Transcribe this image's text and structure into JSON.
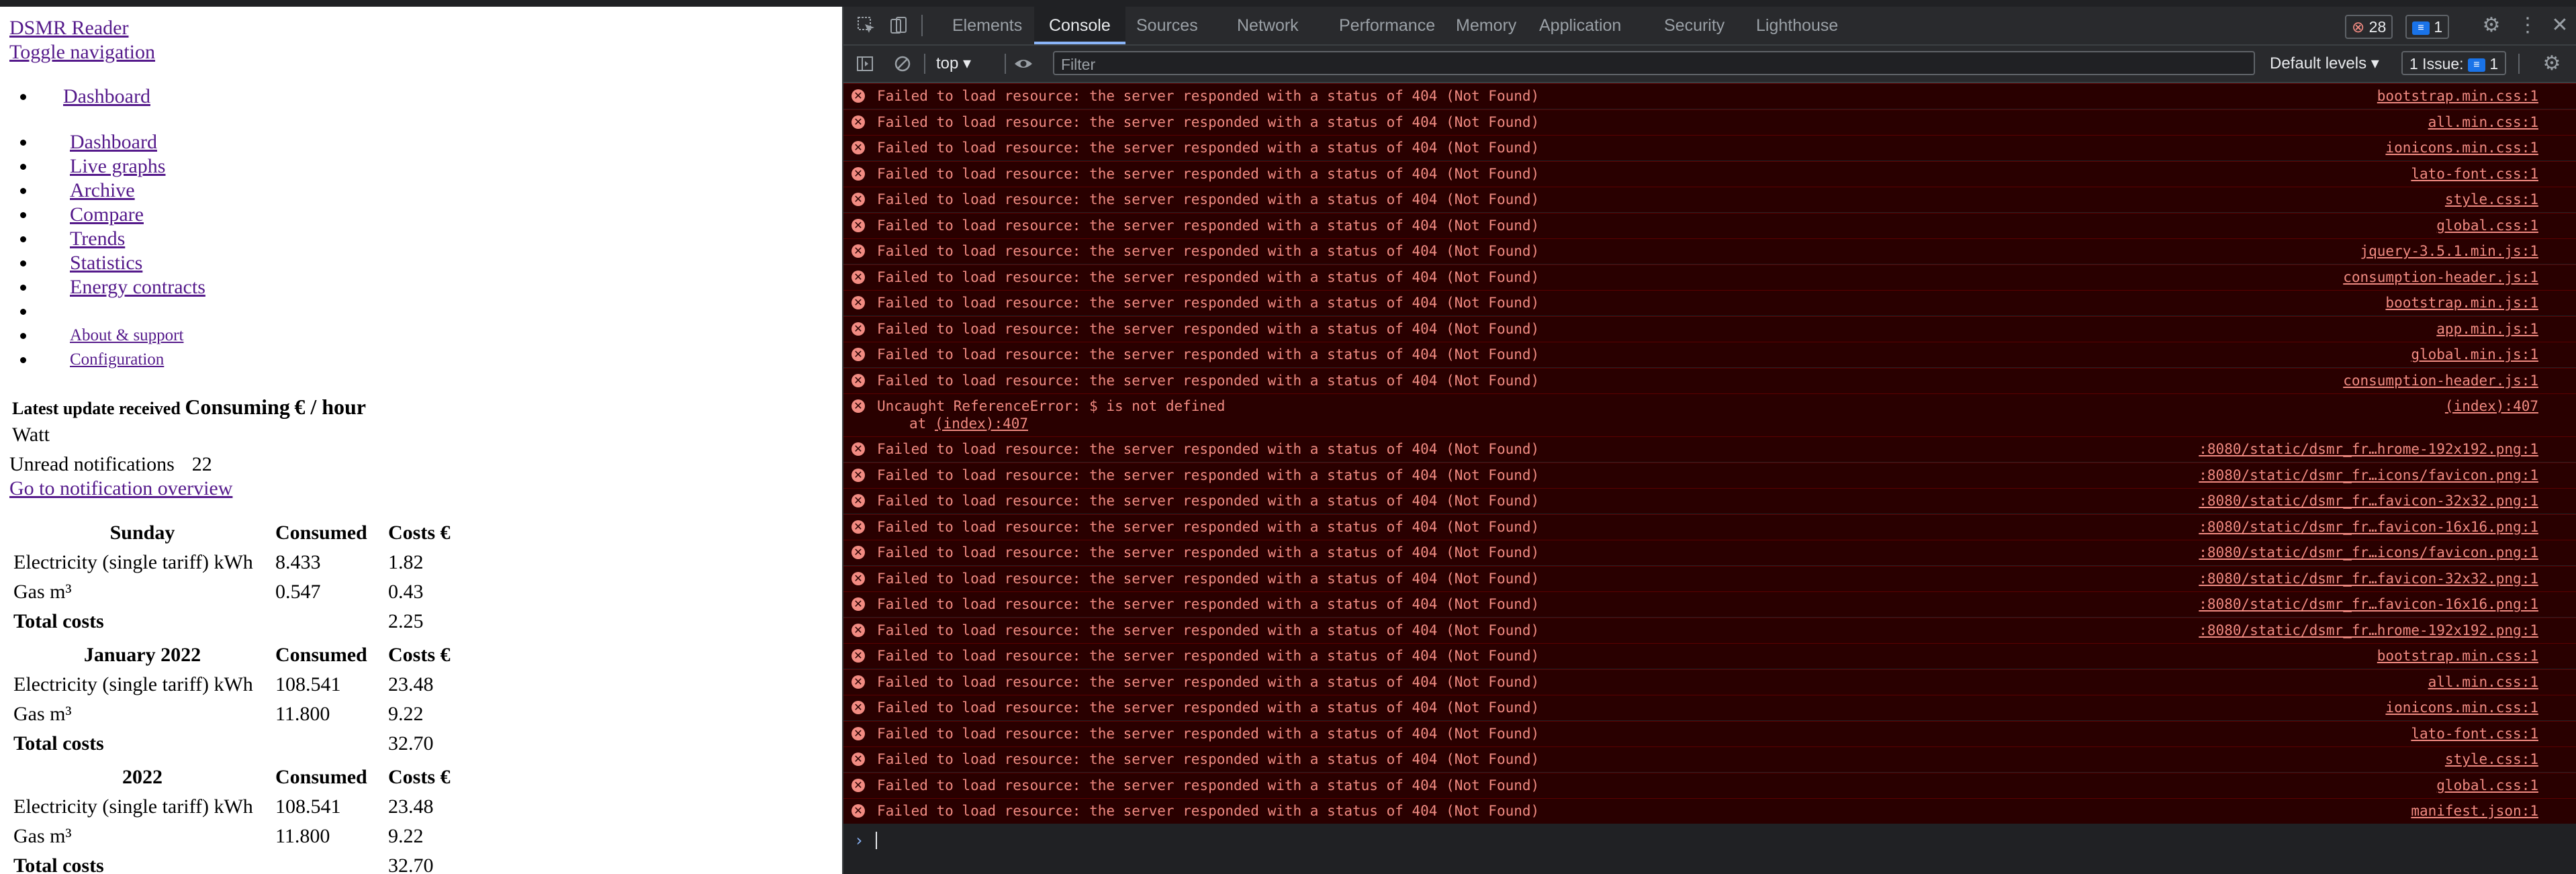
{
  "page": {
    "brand": "DSMR Reader",
    "toggle": "Toggle navigation",
    "nav_dashboard": "Dashboard",
    "menu": [
      {
        "label": "Dashboard",
        "small": false
      },
      {
        "label": "Live graphs",
        "small": false
      },
      {
        "label": "Archive",
        "small": false
      },
      {
        "label": "Compare",
        "small": false
      },
      {
        "label": "Trends",
        "small": false
      },
      {
        "label": "Statistics",
        "small": false
      },
      {
        "label": "Energy contracts",
        "small": false
      },
      {
        "label": "",
        "small": false
      },
      {
        "label": "About & support",
        "small": true
      },
      {
        "label": "Configuration",
        "small": true
      }
    ],
    "latest_update": "Latest update received",
    "consuming": "Consuming",
    "per_hour": "€ / hour",
    "watt": "Watt",
    "unread_label": "Unread notifications",
    "unread_count": "22",
    "notif_link": "Go to notification overview",
    "tables": [
      {
        "heading": "Sunday",
        "consumed": "Consumed",
        "costs": "Costs €",
        "rows": [
          {
            "label": "Electricity (single tariff) kWh",
            "consumed": "8.433",
            "costs": "1.82"
          },
          {
            "label": "Gas m³",
            "consumed": "0.547",
            "costs": "0.43"
          }
        ],
        "total_label": "Total costs",
        "total": "2.25"
      },
      {
        "heading": "January 2022",
        "consumed": "Consumed",
        "costs": "Costs €",
        "rows": [
          {
            "label": "Electricity (single tariff) kWh",
            "consumed": "108.541",
            "costs": "23.48"
          },
          {
            "label": "Gas m³",
            "consumed": "11.800",
            "costs": "9.22"
          }
        ],
        "total_label": "Total costs",
        "total": "32.70"
      },
      {
        "heading": "2022",
        "consumed": "Consumed",
        "costs": "Costs €",
        "rows": [
          {
            "label": "Electricity (single tariff) kWh",
            "consumed": "108.541",
            "costs": "23.48"
          },
          {
            "label": "Gas m³",
            "consumed": "11.800",
            "costs": "9.22"
          }
        ],
        "total_label": "Total costs",
        "total": "32.70"
      }
    ]
  },
  "devtools": {
    "tabs": [
      "Elements",
      "Console",
      "Sources",
      "Network",
      "Performance",
      "Memory",
      "Application",
      "Security",
      "Lighthouse"
    ],
    "active_tab": "Console",
    "error_count": "28",
    "message_count": "1",
    "context": "top",
    "filter_placeholder": "Filter",
    "levels": "Default levels",
    "issues_label": "1 Issue:",
    "issues_count": "1",
    "messages": [
      {
        "text": "Failed to load resource: the server responded with a status of 404 (Not Found)",
        "source": "bootstrap.min.css:1"
      },
      {
        "text": "Failed to load resource: the server responded with a status of 404 (Not Found)",
        "source": "all.min.css:1"
      },
      {
        "text": "Failed to load resource: the server responded with a status of 404 (Not Found)",
        "source": "ionicons.min.css:1"
      },
      {
        "text": "Failed to load resource: the server responded with a status of 404 (Not Found)",
        "source": "lato-font.css:1"
      },
      {
        "text": "Failed to load resource: the server responded with a status of 404 (Not Found)",
        "source": "style.css:1"
      },
      {
        "text": "Failed to load resource: the server responded with a status of 404 (Not Found)",
        "source": "global.css:1"
      },
      {
        "text": "Failed to load resource: the server responded with a status of 404 (Not Found)",
        "source": "jquery-3.5.1.min.js:1"
      },
      {
        "text": "Failed to load resource: the server responded with a status of 404 (Not Found)",
        "source": "consumption-header.js:1"
      },
      {
        "text": "Failed to load resource: the server responded with a status of 404 (Not Found)",
        "source": "bootstrap.min.js:1"
      },
      {
        "text": "Failed to load resource: the server responded with a status of 404 (Not Found)",
        "source": "app.min.js:1"
      },
      {
        "text": "Failed to load resource: the server responded with a status of 404 (Not Found)",
        "source": "global.min.js:1"
      },
      {
        "text": "Failed to load resource: the server responded with a status of 404 (Not Found)",
        "source": "consumption-header.js:1"
      },
      {
        "text": "Uncaught ReferenceError: $ is not defined",
        "source": "(index):407",
        "at_prefix": "at",
        "at_link": "(index):407"
      },
      {
        "text": "Failed to load resource: the server responded with a status of 404 (Not Found)",
        "source": ":8080/static/dsmr_fr…hrome-192x192.png:1"
      },
      {
        "text": "Failed to load resource: the server responded with a status of 404 (Not Found)",
        "source": ":8080/static/dsmr_fr…icons/favicon.png:1"
      },
      {
        "text": "Failed to load resource: the server responded with a status of 404 (Not Found)",
        "source": ":8080/static/dsmr_fr…favicon-32x32.png:1"
      },
      {
        "text": "Failed to load resource: the server responded with a status of 404 (Not Found)",
        "source": ":8080/static/dsmr_fr…favicon-16x16.png:1"
      },
      {
        "text": "Failed to load resource: the server responded with a status of 404 (Not Found)",
        "source": ":8080/static/dsmr_fr…icons/favicon.png:1"
      },
      {
        "text": "Failed to load resource: the server responded with a status of 404 (Not Found)",
        "source": ":8080/static/dsmr_fr…favicon-32x32.png:1"
      },
      {
        "text": "Failed to load resource: the server responded with a status of 404 (Not Found)",
        "source": ":8080/static/dsmr_fr…favicon-16x16.png:1"
      },
      {
        "text": "Failed to load resource: the server responded with a status of 404 (Not Found)",
        "source": ":8080/static/dsmr_fr…hrome-192x192.png:1"
      },
      {
        "text": "Failed to load resource: the server responded with a status of 404 (Not Found)",
        "source": "bootstrap.min.css:1"
      },
      {
        "text": "Failed to load resource: the server responded with a status of 404 (Not Found)",
        "source": "all.min.css:1"
      },
      {
        "text": "Failed to load resource: the server responded with a status of 404 (Not Found)",
        "source": "ionicons.min.css:1"
      },
      {
        "text": "Failed to load resource: the server responded with a status of 404 (Not Found)",
        "source": "lato-font.css:1"
      },
      {
        "text": "Failed to load resource: the server responded with a status of 404 (Not Found)",
        "source": "style.css:1"
      },
      {
        "text": "Failed to load resource: the server responded with a status of 404 (Not Found)",
        "source": "global.css:1"
      },
      {
        "text": "Failed to load resource: the server responded with a status of 404 (Not Found)",
        "source": "manifest.json:1"
      }
    ],
    "prompt_symbol": "›"
  }
}
